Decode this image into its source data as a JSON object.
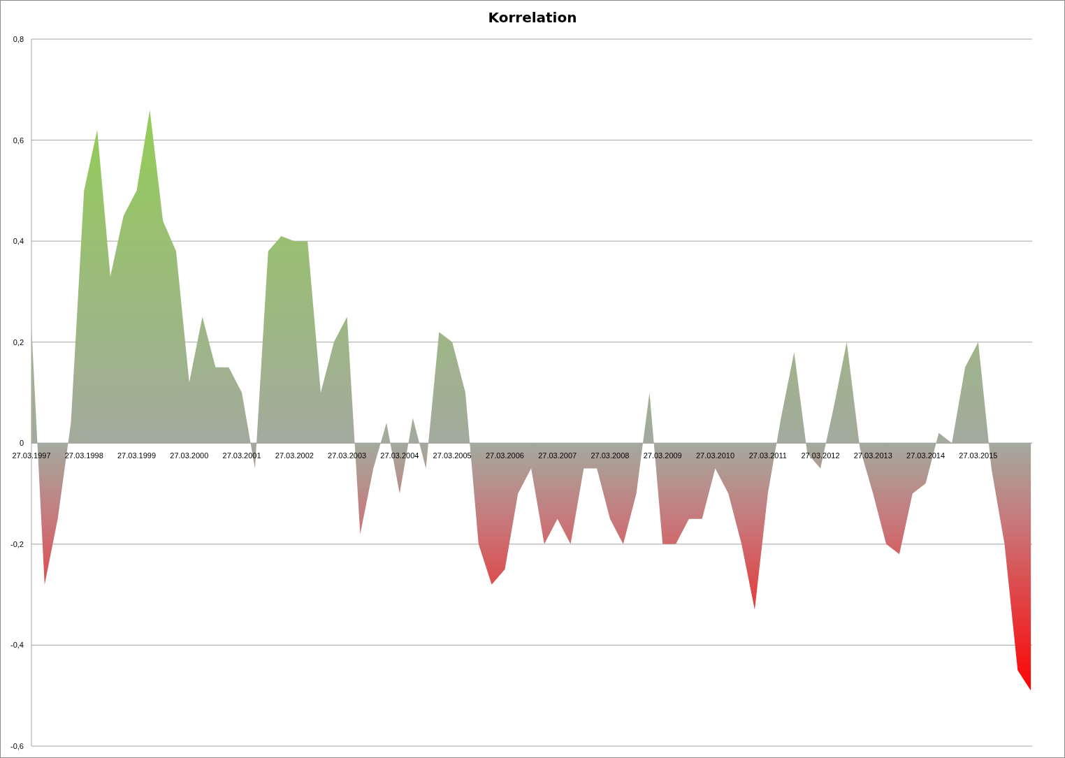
{
  "chart": {
    "chart_data": {
      "type": "area",
      "title": "Korrelation",
      "categories": [
        "27.03.1997",
        null,
        null,
        null,
        "27.03.1998",
        null,
        null,
        null,
        "27.03.1999",
        null,
        null,
        null,
        "27.03.2000",
        null,
        null,
        null,
        "27.03.2001",
        null,
        null,
        null,
        "27.03.2002",
        null,
        null,
        null,
        "27.03.2003",
        null,
        null,
        null,
        "27.03.2004",
        null,
        null,
        null,
        "27.03.2005",
        null,
        null,
        null,
        "27.03.2006",
        null,
        null,
        null,
        "27.03.2007",
        null,
        null,
        null,
        "27.03.2008",
        null,
        null,
        null,
        "27.03.2009",
        null,
        null,
        null,
        "27.03.2010",
        null,
        null,
        null,
        "27.03.2011",
        null,
        null,
        null,
        "27.03.2012",
        null,
        null,
        null,
        "27.03.2013",
        null,
        null,
        null,
        "27.03.2014",
        null,
        null,
        null,
        "27.03.2015",
        null,
        null,
        null,
        null
      ],
      "series": [
        {
          "color": "#92d050",
          "values": [
            0.23,
            -0.28,
            -0.15,
            0.04,
            0.5,
            0.62,
            0.33,
            0.45,
            0.5,
            0.66,
            0.44,
            0.38,
            0.12,
            0.25,
            0.15,
            0.15,
            0.1,
            -0.05,
            0.38,
            0.41,
            0.4,
            0.4,
            0.1,
            0.2,
            0.25,
            -0.18,
            -0.05,
            0.04,
            -0.1,
            0.05,
            -0.05,
            0.22,
            0.2,
            0.1,
            -0.2,
            -0.28,
            -0.25,
            -0.1,
            -0.05,
            -0.2,
            -0.15,
            -0.2,
            -0.05,
            -0.05,
            -0.15,
            -0.2,
            -0.1,
            0.1,
            -0.2,
            -0.2,
            -0.15,
            -0.15,
            -0.05,
            -0.1,
            -0.2,
            -0.33,
            -0.1,
            0.05,
            0.18,
            -0.02,
            -0.05,
            0.07,
            0.2,
            -0.01,
            -0.1,
            -0.2,
            -0.22,
            -0.1,
            -0.08,
            0.02,
            0,
            0.15,
            0.2,
            -0.05,
            -0.2,
            -0.45,
            -0.49
          ]
        }
      ],
      "ylim": [
        -0.6,
        0.8
      ],
      "grid": true,
      "yticks": [
        {
          "value": -0.6,
          "label": "-0,6"
        },
        {
          "value": -0.4,
          "label": "-0,4"
        },
        {
          "value": -0.2,
          "label": "-0,2"
        },
        {
          "value": 0,
          "label": "0"
        },
        {
          "value": 0.2,
          "label": "0,2"
        },
        {
          "value": 0.4,
          "label": "0,4"
        },
        {
          "value": 0.6,
          "label": "0,6"
        },
        {
          "value": 0.8,
          "label": "0,8"
        }
      ]
    }
  }
}
